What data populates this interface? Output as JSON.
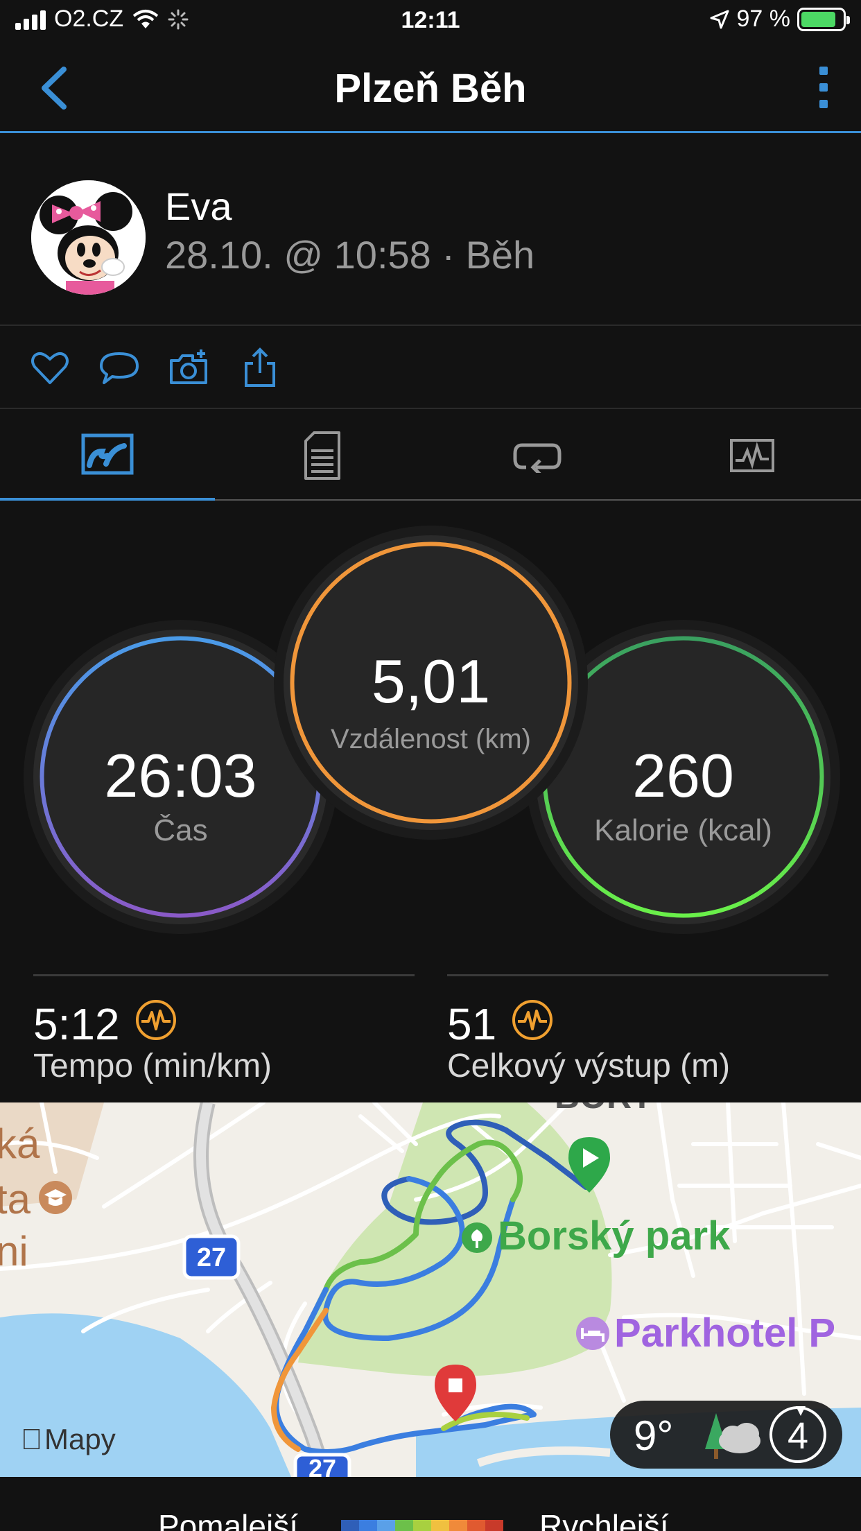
{
  "status_bar": {
    "carrier": "O2.CZ",
    "time": "12:11",
    "battery": "97 %"
  },
  "header": {
    "title": "Plzeň Běh"
  },
  "user": {
    "name": "Eva",
    "meta": "28.10. @ 10:58 · Běh"
  },
  "actions": [
    "heart-icon",
    "comment-icon",
    "camera-add-icon",
    "share-icon"
  ],
  "tabs": [
    "overview-map-icon",
    "details-document-icon",
    "laps-repeat-icon",
    "charts-icon"
  ],
  "active_tab": 0,
  "rings": {
    "time": {
      "value": "26:03",
      "label": "Čas"
    },
    "distance": {
      "value": "5,01",
      "label": "Vzdálenost (km)"
    },
    "calories": {
      "value": "260",
      "label": "Kalorie (kcal)"
    }
  },
  "stats": {
    "pace": {
      "value": "5:12",
      "label": "Tempo (min/km)"
    },
    "ascent": {
      "value": "51",
      "label": "Celkový výstup (m)"
    }
  },
  "map": {
    "labels": {
      "road_number": "27",
      "park": "Borský park",
      "hotel": "Parkhotel P",
      "top_fragment": "BORY",
      "left_fragment_1": "ká",
      "left_fragment_2": "ta",
      "left_fragment_3": "ni",
      "attribution": "Mapy"
    },
    "weather": {
      "temperature": "9°",
      "wind": "4"
    }
  },
  "legend": {
    "slower": "Pomalejší",
    "faster": "Rychlejší",
    "colors": [
      "#2f5fb8",
      "#3b7ee0",
      "#5aa0e8",
      "#6cc04a",
      "#a8d040",
      "#f0c040",
      "#f08a3a",
      "#e05a30",
      "#c83a2a"
    ]
  },
  "colors": {
    "accent": "#3a8fd6",
    "time_ring": "#5a8fe0",
    "distance_ring": "#f0963a",
    "calories_ring": "#5ae050",
    "pulse_icon": "#f0a030"
  }
}
